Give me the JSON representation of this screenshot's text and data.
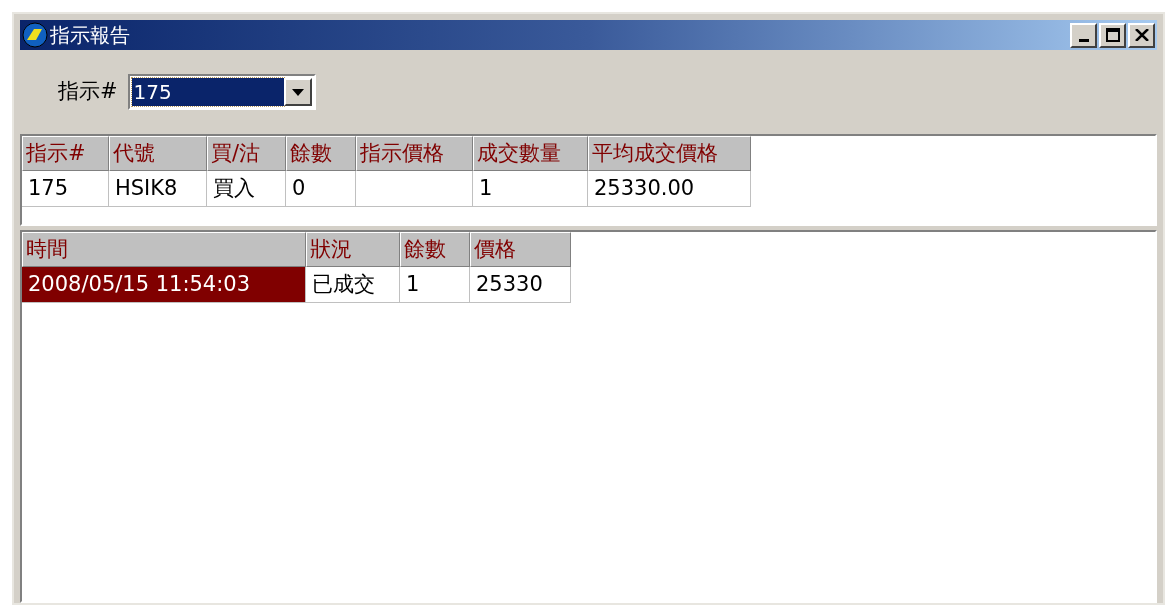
{
  "window": {
    "title": "指示報告"
  },
  "order_picker": {
    "label": "指示#",
    "value": "175"
  },
  "orders_table": {
    "columns": [
      "指示#",
      "代號",
      "買/沽",
      "餘數",
      "指示價格",
      "成交數量",
      "平均成交價格"
    ],
    "rows": [
      {
        "cells": [
          "175",
          "HSIK8",
          "買入",
          "0",
          "",
          "1",
          "25330.00"
        ]
      }
    ]
  },
  "history_table": {
    "columns": [
      "時間",
      "狀況",
      "餘數",
      "價格"
    ],
    "rows": [
      {
        "cells": [
          "2008/05/15 11:54:03",
          "已成交",
          "1",
          "25330"
        ],
        "selected": true
      }
    ]
  }
}
